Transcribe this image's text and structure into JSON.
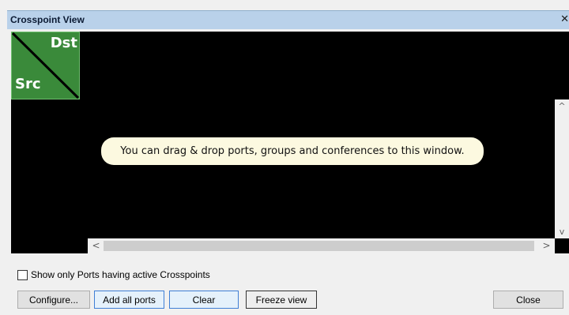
{
  "window": {
    "title": "Crosspoint View",
    "close_glyph": "✕"
  },
  "corner": {
    "dst_label": "Dst",
    "src_label": "Src",
    "tile_color": "#3a8a3a"
  },
  "hint": {
    "text": "You can drag & drop ports, groups and conferences to this window."
  },
  "scrollbars": {
    "up_glyph": "^",
    "down_glyph": "v",
    "left_glyph": "<",
    "right_glyph": ">"
  },
  "options": {
    "show_active_label": "Show only Ports having active Crosspoints",
    "show_active_checked": false
  },
  "buttons": {
    "configure": "Configure...",
    "add_all_ports": "Add all ports",
    "clear": "Clear",
    "freeze_view": "Freeze view",
    "close": "Close"
  }
}
